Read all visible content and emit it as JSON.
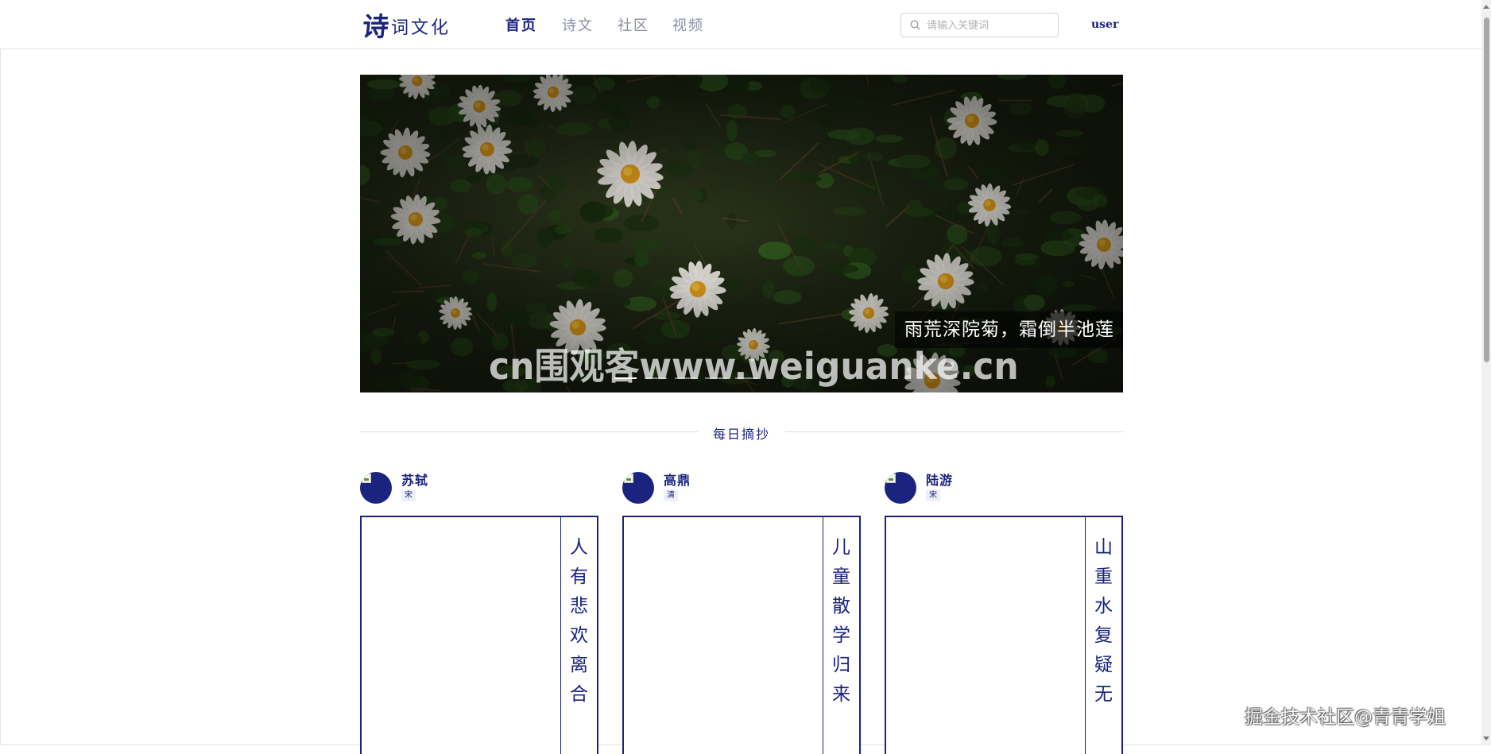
{
  "header": {
    "logo_big": "诗",
    "logo_small": "词文化",
    "nav": [
      {
        "label": "首页",
        "active": true
      },
      {
        "label": "诗文",
        "active": false
      },
      {
        "label": "社区",
        "active": false
      },
      {
        "label": "视频",
        "active": false
      }
    ],
    "search_placeholder": "请输入关键词",
    "user_label": "user"
  },
  "banner": {
    "caption": "雨荒深院菊，霜倒半池莲",
    "slide_count": 5,
    "active_slide": 0,
    "watermark": "cn围观客www.weiguanke.cn"
  },
  "section": {
    "title": "每日摘抄"
  },
  "cards": [
    {
      "author": "苏轼",
      "dynasty": "宋",
      "line": "人有悲欢离合"
    },
    {
      "author": "高鼎",
      "dynasty": "清",
      "line": "儿童散学归来"
    },
    {
      "author": "陆游",
      "dynasty": "宋",
      "line": "山重水复疑无"
    }
  ],
  "footer_watermark": "掘金技术社区@青青学姐",
  "colors": {
    "brand": "#1a237e",
    "nav_inactive": "#8a8fa6",
    "border": "#e6e6e6"
  }
}
